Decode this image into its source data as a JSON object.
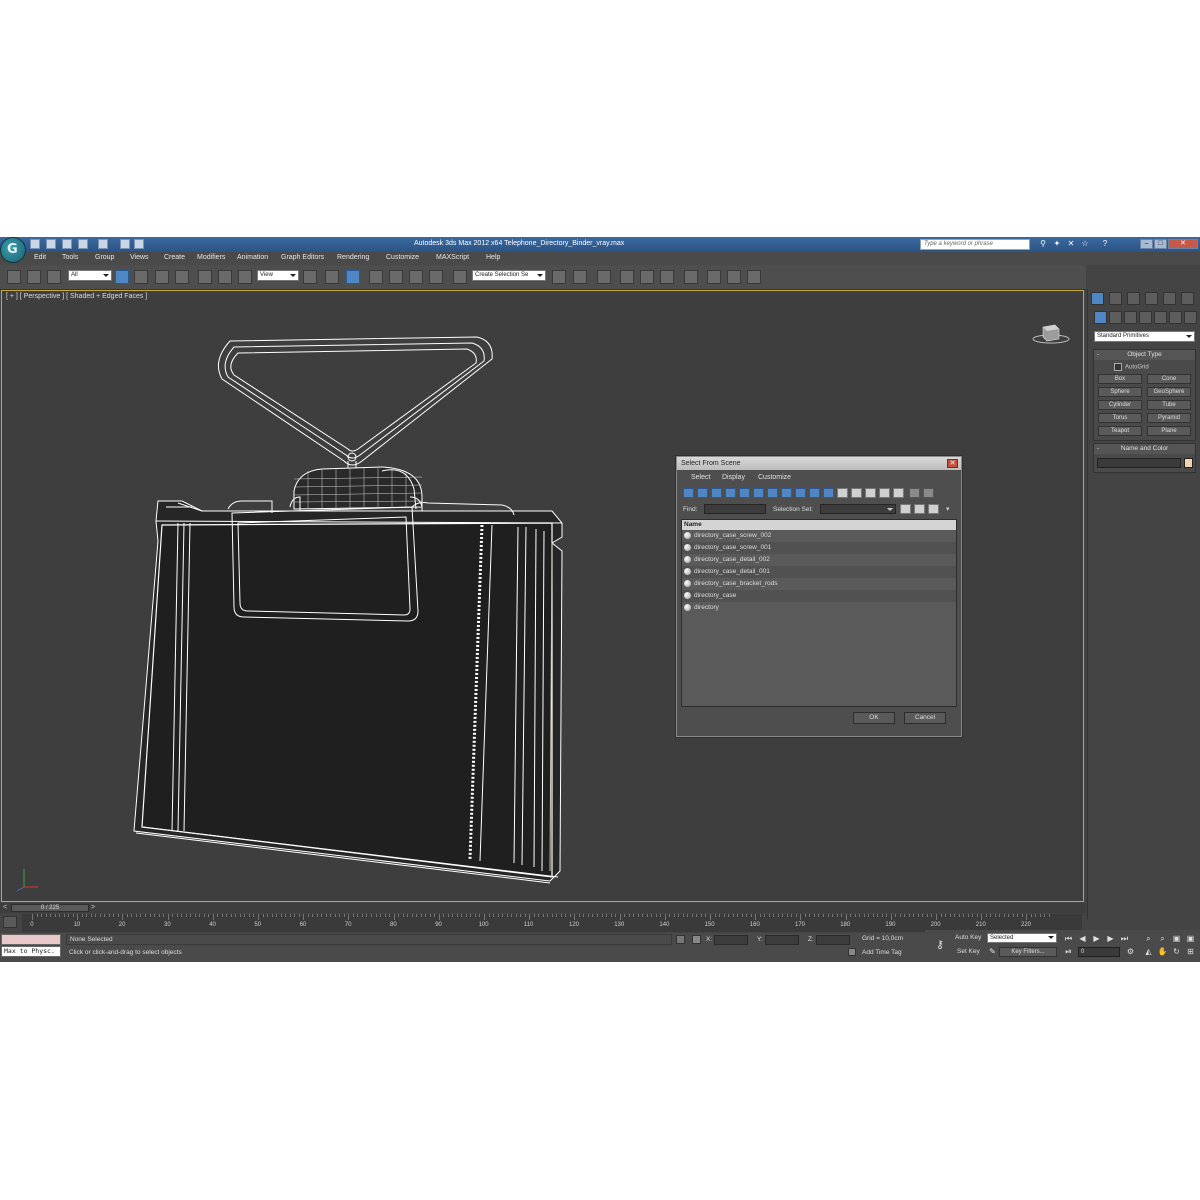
{
  "window": {
    "title": "Autodesk 3ds Max  2012 x64     Telephone_Directory_Binder_vray.max",
    "search_placeholder": "Type a keyword or phrase",
    "app_logo": "3ds-max-logo",
    "minimize": "–",
    "maximize": "□",
    "close": "✕",
    "help_label": "?"
  },
  "menubar": [
    "Edit",
    "Tools",
    "Group",
    "Views",
    "Create",
    "Modifiers",
    "Animation",
    "Graph Editors",
    "Rendering",
    "Customize",
    "MAXScript",
    "Help"
  ],
  "toolbar": {
    "selection_filter": "All",
    "reference_coord": "View",
    "named_selection": "Create Selection Se"
  },
  "viewport": {
    "label": "[ + ] [ Perspective ] [ Shaded + Edged Faces ]"
  },
  "command_panel": {
    "category": "Standard Primitives",
    "object_type_title": "Object Type",
    "collapse_sign": "-",
    "autogrid_label": "AutoGrid",
    "primitives": [
      "Box",
      "Cone",
      "Sphere",
      "GeoSphere",
      "Cylinder",
      "Tube",
      "Torus",
      "Pyramid",
      "Teapot",
      "Plane"
    ],
    "name_color_title": "Name and Color",
    "object_color": "#f2d3b0"
  },
  "time_slider": {
    "position": "0 / 225",
    "prev": "<",
    "next": ">"
  },
  "trackbar": {
    "ticks": [
      "0",
      "10",
      "20",
      "30",
      "40",
      "50",
      "60",
      "70",
      "80",
      "90",
      "100",
      "110",
      "120",
      "130",
      "140",
      "150",
      "160",
      "170",
      "180",
      "190",
      "200",
      "210",
      "220"
    ]
  },
  "status": {
    "maxscript_output": "Max to Physc.",
    "selection_status": "None Selected",
    "prompt": "Click or click-and-drag to select objects",
    "x_label": "X:",
    "y_label": "Y:",
    "z_label": "Z:",
    "grid": "Grid = 10,0cm",
    "add_time_tag": "Add Time Tag"
  },
  "animation": {
    "auto_key": "Auto Key",
    "key_mode": "Selected",
    "set_key": "Set Key",
    "key_filters": "Key Filters...",
    "current_frame": "0"
  },
  "dialog": {
    "title": "Select From Scene",
    "close": "✕",
    "menu": [
      "Select",
      "Display",
      "Customize"
    ],
    "find_label": "Find:",
    "selection_set_label": "Selection Set:",
    "column_name": "Name",
    "objects": [
      "directory_case_screw_002",
      "directory_case_screw_001",
      "directory_case_detail_002",
      "directory_case_detail_001",
      "directory_case_bracket_rods",
      "directory_case",
      "directory"
    ],
    "ok": "OK",
    "cancel": "Cancel"
  },
  "accent_colors": {
    "active_tool": "#4f87c4",
    "viewport_border": "#c8a838",
    "wireframe": "#ffffff"
  }
}
